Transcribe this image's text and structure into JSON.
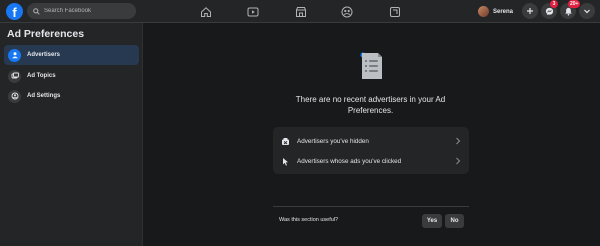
{
  "header": {
    "logo": "f",
    "search": {
      "placeholder": "Search Facebook"
    },
    "nav_icons": [
      "home-icon",
      "watch-icon",
      "marketplace-icon",
      "groups-icon",
      "gaming-icon"
    ],
    "profile": {
      "name": "Serena"
    },
    "messenger_badge": "3",
    "notifications_badge": "20+"
  },
  "sidebar": {
    "title": "Ad Preferences",
    "items": [
      {
        "label": "Advertisers",
        "icon": "advertisers-icon",
        "active": true
      },
      {
        "label": "Ad Topics",
        "icon": "ad-topics-icon",
        "active": false
      },
      {
        "label": "Ad Settings",
        "icon": "ad-settings-icon",
        "active": false
      }
    ]
  },
  "main": {
    "empty_message": "There are no recent advertisers in your Ad Preferences.",
    "rows": [
      {
        "label": "Advertisers you've hidden",
        "icon": "hidden-icon"
      },
      {
        "label": "Advertisers whose ads you've clicked",
        "icon": "cursor-icon"
      }
    ],
    "feedback": {
      "question": "Was this section useful?",
      "yes": "Yes",
      "no": "No"
    }
  },
  "colors": {
    "accent": "#1877f2",
    "badge": "#e41e3f",
    "background": "#18191a",
    "surface": "#242526"
  }
}
